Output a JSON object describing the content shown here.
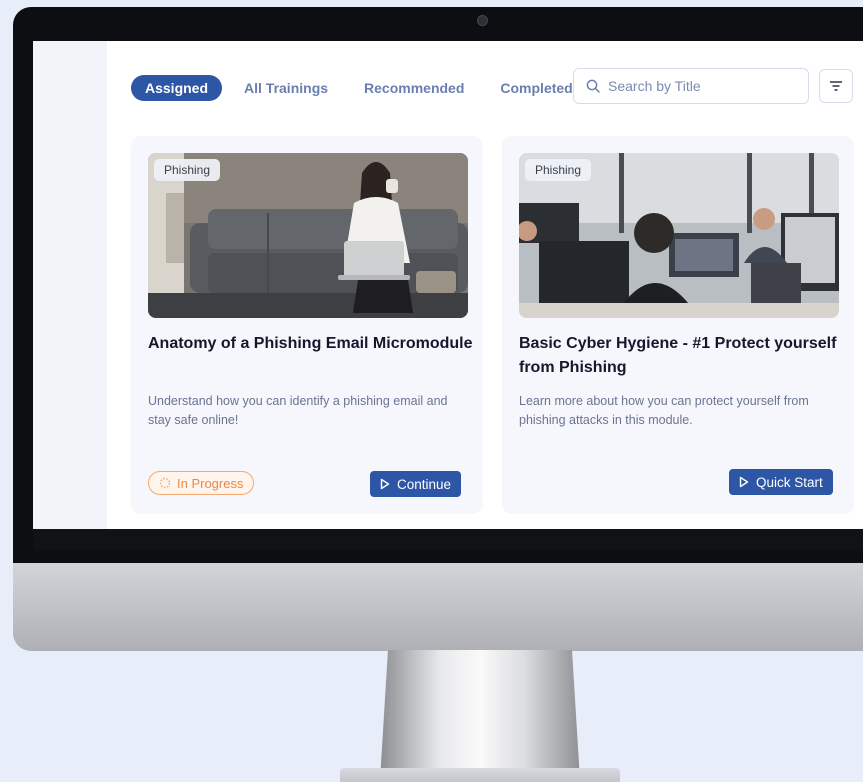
{
  "tabs": [
    {
      "label": "Assigned",
      "active": true
    },
    {
      "label": "All Trainings",
      "active": false
    },
    {
      "label": "Recommended",
      "active": false
    },
    {
      "label": "Completed",
      "active": false
    }
  ],
  "search": {
    "placeholder": "Search by Title",
    "icon": "search-icon"
  },
  "filter": {
    "icon": "filter-icon"
  },
  "cards": [
    {
      "tag": "Phishing",
      "title": "Anatomy of a Phishing Email Micromodule",
      "description": "Understand how you can identify a phishing email and stay safe online!",
      "status": "In Progress",
      "action": "Continue",
      "image": "woman-sitting-on-sofa-with-laptop-drinking-coffee"
    },
    {
      "tag": "Phishing",
      "title": "Basic Cyber Hygiene - #1 Protect yourself from Phishing",
      "description": "Learn more about how you can protect yourself from phishing attacks in this module.",
      "action": "Quick Start",
      "image": "people-working-at-computers-in-office"
    }
  ],
  "colors": {
    "primary": "#2e56a6",
    "tab_inactive": "#6a7fb0",
    "status_orange": "#e98a48",
    "background": "#e8eef9"
  }
}
